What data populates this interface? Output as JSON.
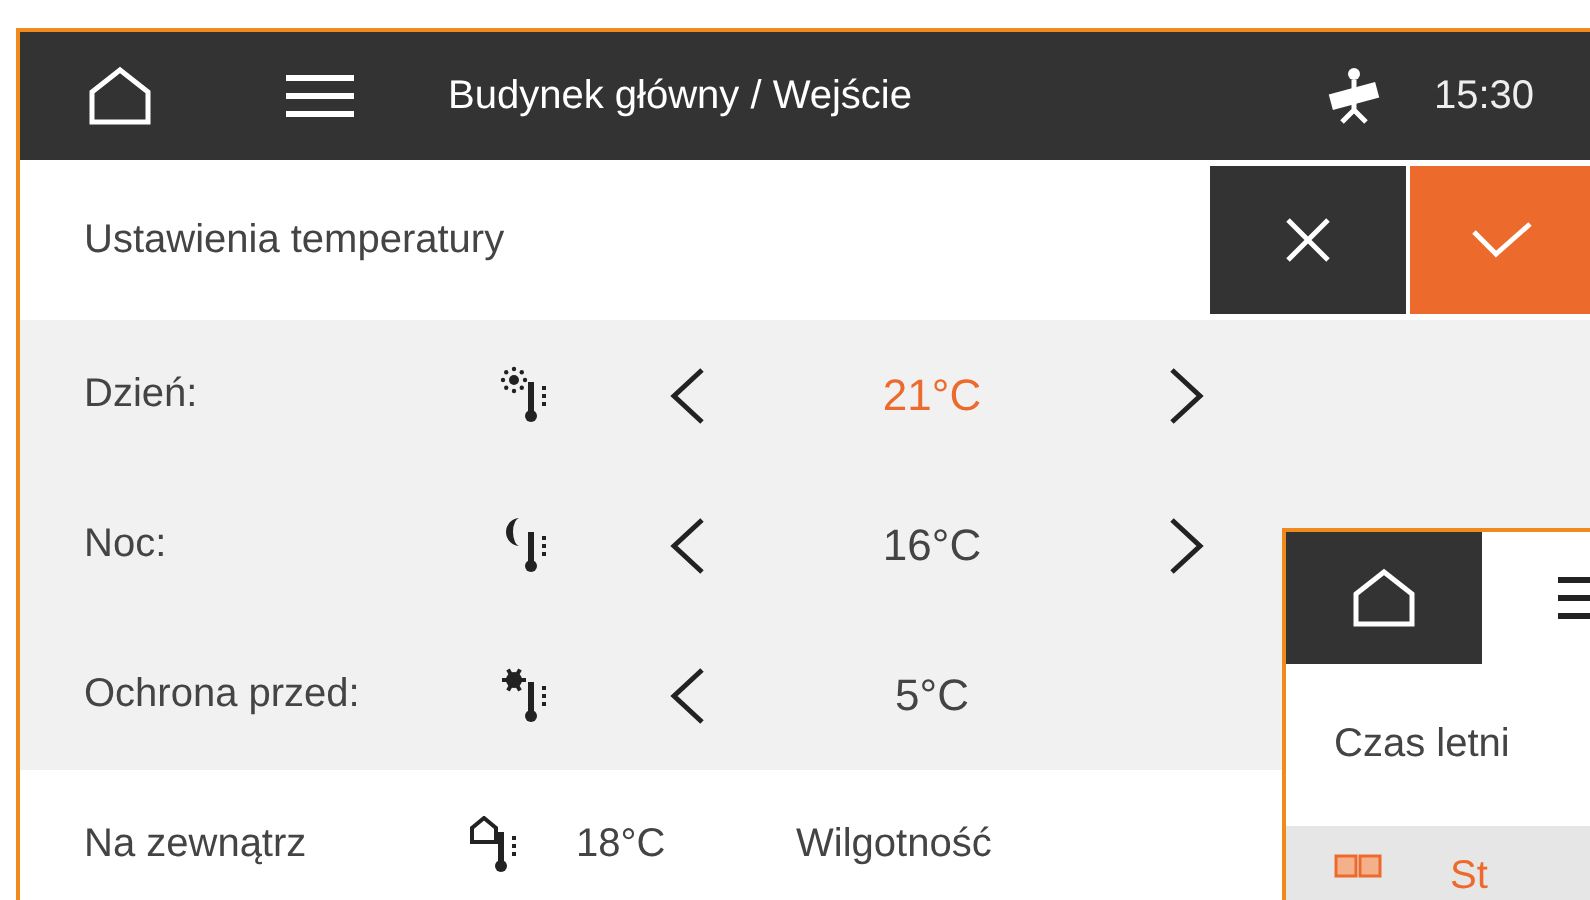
{
  "header": {
    "breadcrumb": "Budynek główny / Wejście",
    "time": "15:30"
  },
  "panel": {
    "title": "Ustawienia temperatury"
  },
  "rows": [
    {
      "kind": "sun",
      "label": "Dzień:",
      "value": "21°C",
      "highlighted": true,
      "has_next": true
    },
    {
      "kind": "moon",
      "label": "Noc:",
      "value": "16°C",
      "highlighted": false,
      "has_next": true
    },
    {
      "kind": "snow",
      "label": "Ochrona przed:",
      "value": "5°C",
      "highlighted": false,
      "has_next": false
    }
  ],
  "outdoor": {
    "label": "Na zewnątrz",
    "value": "18°C",
    "humidity_label": "Wilgotność"
  },
  "overlay": {
    "title": "Czas letni",
    "item": "St"
  }
}
